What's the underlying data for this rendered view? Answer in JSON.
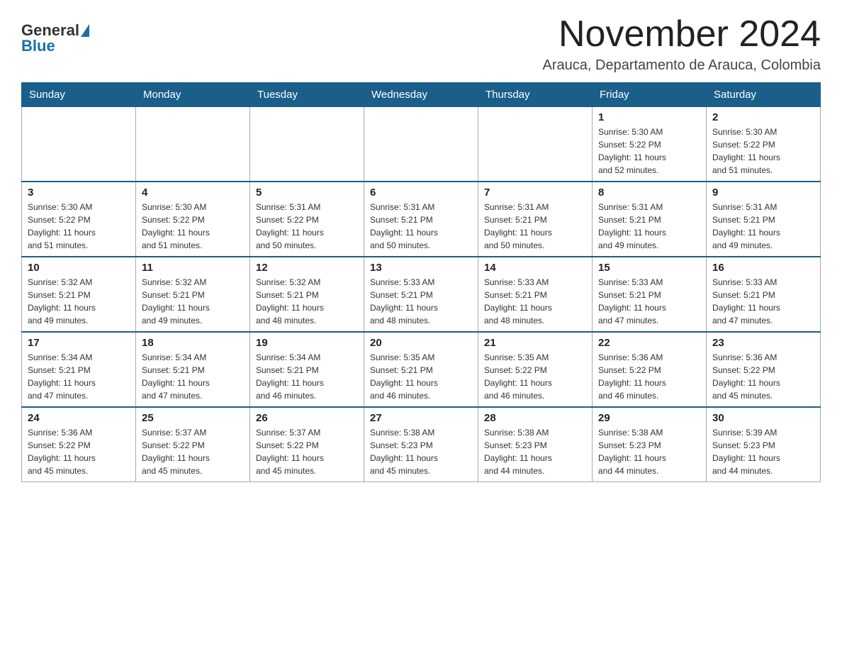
{
  "logo": {
    "general": "General",
    "blue": "Blue"
  },
  "header": {
    "title": "November 2024",
    "location": "Arauca, Departamento de Arauca, Colombia"
  },
  "weekdays": [
    "Sunday",
    "Monday",
    "Tuesday",
    "Wednesday",
    "Thursday",
    "Friday",
    "Saturday"
  ],
  "weeks": [
    {
      "days": [
        {
          "num": "",
          "info": ""
        },
        {
          "num": "",
          "info": ""
        },
        {
          "num": "",
          "info": ""
        },
        {
          "num": "",
          "info": ""
        },
        {
          "num": "",
          "info": ""
        },
        {
          "num": "1",
          "info": "Sunrise: 5:30 AM\nSunset: 5:22 PM\nDaylight: 11 hours\nand 52 minutes."
        },
        {
          "num": "2",
          "info": "Sunrise: 5:30 AM\nSunset: 5:22 PM\nDaylight: 11 hours\nand 51 minutes."
        }
      ]
    },
    {
      "days": [
        {
          "num": "3",
          "info": "Sunrise: 5:30 AM\nSunset: 5:22 PM\nDaylight: 11 hours\nand 51 minutes."
        },
        {
          "num": "4",
          "info": "Sunrise: 5:30 AM\nSunset: 5:22 PM\nDaylight: 11 hours\nand 51 minutes."
        },
        {
          "num": "5",
          "info": "Sunrise: 5:31 AM\nSunset: 5:22 PM\nDaylight: 11 hours\nand 50 minutes."
        },
        {
          "num": "6",
          "info": "Sunrise: 5:31 AM\nSunset: 5:21 PM\nDaylight: 11 hours\nand 50 minutes."
        },
        {
          "num": "7",
          "info": "Sunrise: 5:31 AM\nSunset: 5:21 PM\nDaylight: 11 hours\nand 50 minutes."
        },
        {
          "num": "8",
          "info": "Sunrise: 5:31 AM\nSunset: 5:21 PM\nDaylight: 11 hours\nand 49 minutes."
        },
        {
          "num": "9",
          "info": "Sunrise: 5:31 AM\nSunset: 5:21 PM\nDaylight: 11 hours\nand 49 minutes."
        }
      ]
    },
    {
      "days": [
        {
          "num": "10",
          "info": "Sunrise: 5:32 AM\nSunset: 5:21 PM\nDaylight: 11 hours\nand 49 minutes."
        },
        {
          "num": "11",
          "info": "Sunrise: 5:32 AM\nSunset: 5:21 PM\nDaylight: 11 hours\nand 49 minutes."
        },
        {
          "num": "12",
          "info": "Sunrise: 5:32 AM\nSunset: 5:21 PM\nDaylight: 11 hours\nand 48 minutes."
        },
        {
          "num": "13",
          "info": "Sunrise: 5:33 AM\nSunset: 5:21 PM\nDaylight: 11 hours\nand 48 minutes."
        },
        {
          "num": "14",
          "info": "Sunrise: 5:33 AM\nSunset: 5:21 PM\nDaylight: 11 hours\nand 48 minutes."
        },
        {
          "num": "15",
          "info": "Sunrise: 5:33 AM\nSunset: 5:21 PM\nDaylight: 11 hours\nand 47 minutes."
        },
        {
          "num": "16",
          "info": "Sunrise: 5:33 AM\nSunset: 5:21 PM\nDaylight: 11 hours\nand 47 minutes."
        }
      ]
    },
    {
      "days": [
        {
          "num": "17",
          "info": "Sunrise: 5:34 AM\nSunset: 5:21 PM\nDaylight: 11 hours\nand 47 minutes."
        },
        {
          "num": "18",
          "info": "Sunrise: 5:34 AM\nSunset: 5:21 PM\nDaylight: 11 hours\nand 47 minutes."
        },
        {
          "num": "19",
          "info": "Sunrise: 5:34 AM\nSunset: 5:21 PM\nDaylight: 11 hours\nand 46 minutes."
        },
        {
          "num": "20",
          "info": "Sunrise: 5:35 AM\nSunset: 5:21 PM\nDaylight: 11 hours\nand 46 minutes."
        },
        {
          "num": "21",
          "info": "Sunrise: 5:35 AM\nSunset: 5:22 PM\nDaylight: 11 hours\nand 46 minutes."
        },
        {
          "num": "22",
          "info": "Sunrise: 5:36 AM\nSunset: 5:22 PM\nDaylight: 11 hours\nand 46 minutes."
        },
        {
          "num": "23",
          "info": "Sunrise: 5:36 AM\nSunset: 5:22 PM\nDaylight: 11 hours\nand 45 minutes."
        }
      ]
    },
    {
      "days": [
        {
          "num": "24",
          "info": "Sunrise: 5:36 AM\nSunset: 5:22 PM\nDaylight: 11 hours\nand 45 minutes."
        },
        {
          "num": "25",
          "info": "Sunrise: 5:37 AM\nSunset: 5:22 PM\nDaylight: 11 hours\nand 45 minutes."
        },
        {
          "num": "26",
          "info": "Sunrise: 5:37 AM\nSunset: 5:22 PM\nDaylight: 11 hours\nand 45 minutes."
        },
        {
          "num": "27",
          "info": "Sunrise: 5:38 AM\nSunset: 5:23 PM\nDaylight: 11 hours\nand 45 minutes."
        },
        {
          "num": "28",
          "info": "Sunrise: 5:38 AM\nSunset: 5:23 PM\nDaylight: 11 hours\nand 44 minutes."
        },
        {
          "num": "29",
          "info": "Sunrise: 5:38 AM\nSunset: 5:23 PM\nDaylight: 11 hours\nand 44 minutes."
        },
        {
          "num": "30",
          "info": "Sunrise: 5:39 AM\nSunset: 5:23 PM\nDaylight: 11 hours\nand 44 minutes."
        }
      ]
    }
  ]
}
